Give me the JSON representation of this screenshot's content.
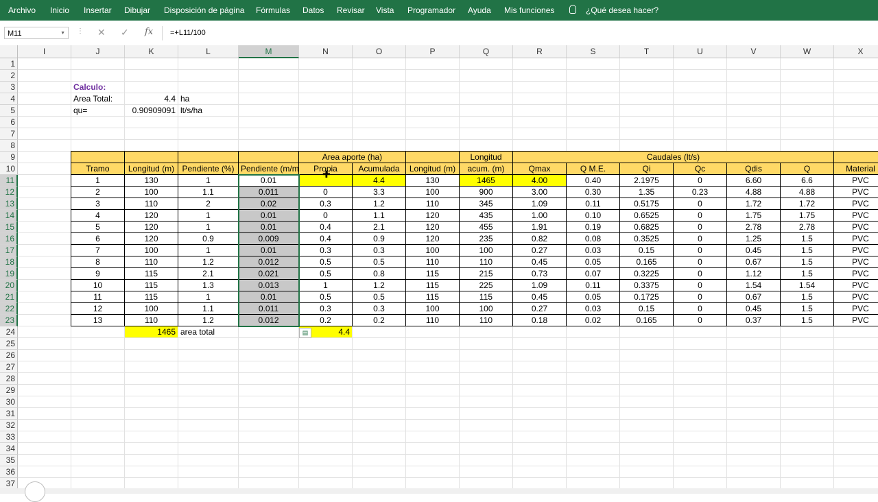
{
  "ribbon": {
    "tabs": [
      "Archivo",
      "Inicio",
      "Insertar",
      "Dibujar",
      "Disposición de página",
      "Fórmulas",
      "Datos",
      "Revisar",
      "Vista",
      "Programador",
      "Ayuda",
      "Mis funciones"
    ],
    "tell_me": "¿Qué desea hacer?",
    "accent": "#217346"
  },
  "formula_bar": {
    "name_box": "M11",
    "formula": "=+L11/100",
    "icons": [
      "cancel-icon",
      "enter-icon",
      "function-icon"
    ]
  },
  "sheet": {
    "columns": [
      "I",
      "J",
      "K",
      "L",
      "M",
      "N",
      "O",
      "P",
      "Q",
      "R",
      "S",
      "T",
      "U",
      "V",
      "W",
      "X"
    ],
    "rows": [
      "1",
      "2",
      "3",
      "4",
      "5",
      "6",
      "7",
      "8",
      "9",
      "10",
      "11",
      "12",
      "13",
      "14",
      "15",
      "16",
      "17",
      "18",
      "19",
      "20",
      "21",
      "22",
      "23",
      "24",
      "25",
      "26",
      "27",
      "28",
      "29",
      "30",
      "31",
      "32",
      "33",
      "34",
      "35",
      "36",
      "37"
    ],
    "selected_column": "M",
    "selected_rows": [
      "11",
      "12",
      "13",
      "14",
      "15",
      "16",
      "17",
      "18",
      "19",
      "20",
      "21",
      "22",
      "23"
    ],
    "colors": {
      "header_fill": "#ffd966",
      "highlight": "#ffff00",
      "selection_fill": "#c8c8c8",
      "title_purple": "#7030a0"
    },
    "calc": {
      "title": "Calculo:",
      "area_label": "Area Total:",
      "area_value": "4.4",
      "area_unit": "ha",
      "qu_label": "qu=",
      "qu_value": "0.90909091",
      "qu_unit": "lt/s/ha"
    },
    "header9": {
      "area_aporte": "Area aporte (ha)",
      "longitud": "Longitud",
      "caudales": "Caudales (lt/s)"
    },
    "header10": [
      "Tramo",
      "Longitud (m)",
      "Pendiente (%)",
      "Pendiente (m/m",
      "Propia",
      "Acumulada",
      "Longitud (m)",
      "acum. (m)",
      "Qmax",
      "Q M.E.",
      "Qi",
      "Qc",
      "Qdis",
      "Q",
      "Material"
    ],
    "table_rows": [
      [
        "1",
        "130",
        "1",
        "0.01",
        "",
        "4.4",
        "130",
        "1465",
        "4.00",
        "0.40",
        "2.1975",
        "0",
        "6.60",
        "6.6",
        "PVC"
      ],
      [
        "2",
        "100",
        "1.1",
        "0.011",
        "0",
        "3.3",
        "100",
        "900",
        "3.00",
        "0.30",
        "1.35",
        "0.23",
        "4.88",
        "4.88",
        "PVC"
      ],
      [
        "3",
        "110",
        "2",
        "0.02",
        "0.3",
        "1.2",
        "110",
        "345",
        "1.09",
        "0.11",
        "0.5175",
        "0",
        "1.72",
        "1.72",
        "PVC"
      ],
      [
        "4",
        "120",
        "1",
        "0.01",
        "0",
        "1.1",
        "120",
        "435",
        "1.00",
        "0.10",
        "0.6525",
        "0",
        "1.75",
        "1.75",
        "PVC"
      ],
      [
        "5",
        "120",
        "1",
        "0.01",
        "0.4",
        "2.1",
        "120",
        "455",
        "1.91",
        "0.19",
        "0.6825",
        "0",
        "2.78",
        "2.78",
        "PVC"
      ],
      [
        "6",
        "120",
        "0.9",
        "0.009",
        "0.4",
        "0.9",
        "120",
        "235",
        "0.82",
        "0.08",
        "0.3525",
        "0",
        "1.25",
        "1.5",
        "PVC"
      ],
      [
        "7",
        "100",
        "1",
        "0.01",
        "0.3",
        "0.3",
        "100",
        "100",
        "0.27",
        "0.03",
        "0.15",
        "0",
        "0.45",
        "1.5",
        "PVC"
      ],
      [
        "8",
        "110",
        "1.2",
        "0.012",
        "0.5",
        "0.5",
        "110",
        "110",
        "0.45",
        "0.05",
        "0.165",
        "0",
        "0.67",
        "1.5",
        "PVC"
      ],
      [
        "9",
        "115",
        "2.1",
        "0.021",
        "0.5",
        "0.8",
        "115",
        "215",
        "0.73",
        "0.07",
        "0.3225",
        "0",
        "1.12",
        "1.5",
        "PVC"
      ],
      [
        "10",
        "115",
        "1.3",
        "0.013",
        "1",
        "1.2",
        "115",
        "225",
        "1.09",
        "0.11",
        "0.3375",
        "0",
        "1.54",
        "1.54",
        "PVC"
      ],
      [
        "11",
        "115",
        "1",
        "0.01",
        "0.5",
        "0.5",
        "115",
        "115",
        "0.45",
        "0.05",
        "0.1725",
        "0",
        "0.67",
        "1.5",
        "PVC"
      ],
      [
        "12",
        "100",
        "1.1",
        "0.011",
        "0.3",
        "0.3",
        "100",
        "100",
        "0.27",
        "0.03",
        "0.15",
        "0",
        "0.45",
        "1.5",
        "PVC"
      ],
      [
        "13",
        "110",
        "1.2",
        "0.012",
        "0.2",
        "0.2",
        "110",
        "110",
        "0.18",
        "0.02",
        "0.165",
        "0",
        "0.37",
        "1.5",
        "PVC"
      ]
    ],
    "totals": {
      "longitud_total": "1465",
      "label": "area total",
      "area_total": "4.4"
    }
  }
}
